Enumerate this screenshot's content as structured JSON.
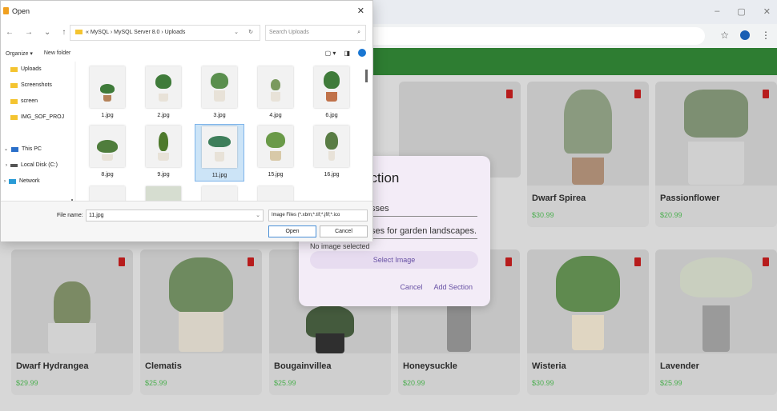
{
  "browser": {
    "window_controls": [
      "–",
      "▢",
      "✕"
    ],
    "addr_icons": [
      "☆",
      "⋮"
    ]
  },
  "products": [
    {
      "name": "Dwarf Spirea",
      "price": "$30.99"
    },
    {
      "name": "Passionflower",
      "price": "$20.99"
    },
    {
      "name": "Dwarf Hydrangea",
      "price": "$29.99"
    },
    {
      "name": "Clematis",
      "price": "$25.99"
    },
    {
      "name": "Bougainvillea",
      "price": "$25.99"
    },
    {
      "name": "Honeysuckle",
      "price": "$20.99"
    },
    {
      "name": "Wisteria",
      "price": "$30.99"
    },
    {
      "name": "Lavender",
      "price": "$25.99"
    }
  ],
  "modal": {
    "title": "ection",
    "field1": "sses",
    "field2": "ses for garden landscapes.",
    "no_image": "No image selected",
    "select_image": "Select Image",
    "cancel": "Cancel",
    "add_section": "Add Section"
  },
  "dialog": {
    "title": "Open",
    "close": "✕",
    "nav": [
      "←",
      "→",
      "⌄",
      "↑"
    ],
    "path": "« MySQL › MySQL Server 8.0 › Uploads",
    "search_placeholder": "Search Uploads",
    "organize": "Organize ▾",
    "new_folder": "New folder",
    "sidebar": [
      {
        "label": "Uploads",
        "icon": "folder"
      },
      {
        "label": "Screenshots",
        "icon": "folder"
      },
      {
        "label": "screen",
        "icon": "folder"
      },
      {
        "label": "IMG_SOF_PROJ",
        "icon": "folder"
      },
      {
        "label": "This PC",
        "icon": "pc"
      },
      {
        "label": "Local Disk (C:)",
        "icon": "disk"
      },
      {
        "label": "Network",
        "icon": "network"
      }
    ],
    "files": [
      "1.jpg",
      "2.jpg",
      "3.jpg",
      "4.jpg",
      "6.jpg",
      "8.jpg",
      "9.jpg",
      "11.jpg",
      "15.jpg",
      "16.jpg"
    ],
    "file_name_label": "File name:",
    "file_name_value": "11.jpg",
    "file_type": "Image Files (*.xbm;*.tif;*.jfif;*.ico",
    "open": "Open",
    "cancel": "Cancel"
  },
  "colors": {
    "accent_green": "#2e7d32",
    "modal_purple": "#6750a4",
    "trash_red": "#b71c1c"
  }
}
